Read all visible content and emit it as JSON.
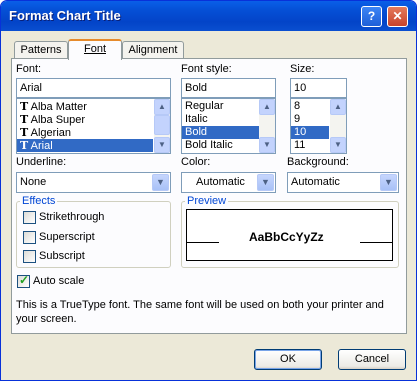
{
  "window": {
    "title": "Format Chart Title",
    "help_glyph": "?",
    "close_glyph": "✕"
  },
  "tabs": [
    {
      "label": "Patterns"
    },
    {
      "label": "Font"
    },
    {
      "label": "Alignment"
    }
  ],
  "font": {
    "label": "Font:",
    "value": "Arial",
    "items": [
      {
        "icon": "truetype-icon",
        "label": "Alba Matter"
      },
      {
        "icon": "truetype-icon",
        "label": "Alba Super"
      },
      {
        "icon": "truetype-icon",
        "label": "Algerian"
      },
      {
        "icon": "truetype-icon",
        "label": "Arial"
      }
    ],
    "selected_index": 3
  },
  "font_style": {
    "label": "Font style:",
    "value": "Bold",
    "items": [
      "Regular",
      "Italic",
      "Bold",
      "Bold Italic"
    ],
    "selected_index": 2
  },
  "size": {
    "label": "Size:",
    "value": "10",
    "items": [
      "8",
      "9",
      "10",
      "11"
    ],
    "selected_index": 2
  },
  "underline": {
    "label": "Underline:",
    "value": "None"
  },
  "color": {
    "label": "Color:",
    "value": "Automatic"
  },
  "background": {
    "label": "Background:",
    "value": "Automatic"
  },
  "effects": {
    "title": "Effects",
    "strikethrough": "Strikethrough",
    "superscript": "Superscript",
    "subscript": "Subscript"
  },
  "preview": {
    "title": "Preview",
    "sample": "AaBbCcYyZz"
  },
  "auto_scale": {
    "label": "Auto scale",
    "checked": true
  },
  "info_text": "This is a TrueType font.  The same font will be used on both your printer and your screen.",
  "buttons": {
    "ok": "OK",
    "cancel": "Cancel"
  },
  "colors": {
    "title_bar": "#0550d6",
    "dialog_bg": "#ece9d8",
    "selection": "#316ac5",
    "tab_accent": "#e68b2c"
  }
}
